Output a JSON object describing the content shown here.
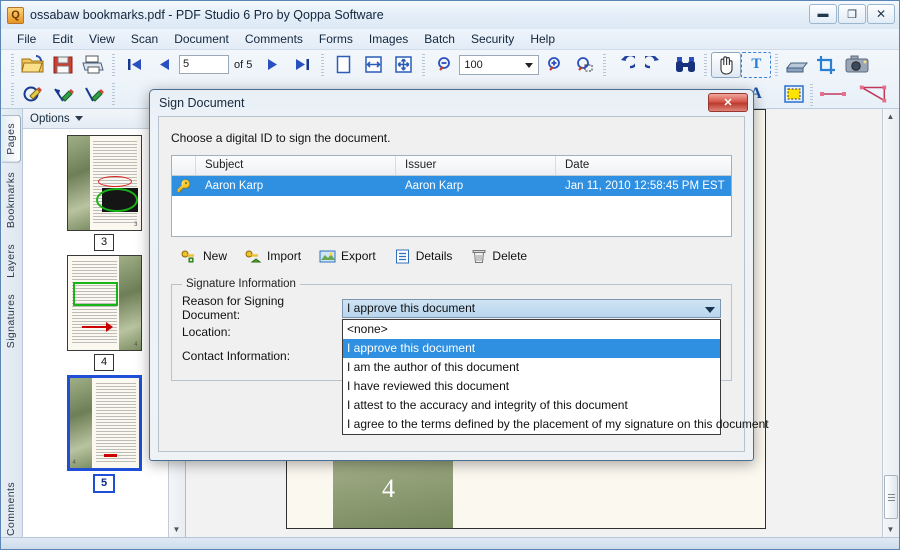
{
  "window": {
    "title": "ossabaw bookmarks.pdf - PDF Studio 6 Pro by Qoppa Software",
    "app_icon": "Q",
    "minimize_label": "▬",
    "maximize_label": "❐",
    "close_label": "✕"
  },
  "menubar": {
    "items": [
      "File",
      "Edit",
      "View",
      "Scan",
      "Document",
      "Comments",
      "Forms",
      "Images",
      "Batch",
      "Security",
      "Help"
    ]
  },
  "toolbar": {
    "open_icon": "open-folder-icon",
    "save_icon": "save-icon",
    "print_icon": "print-icon",
    "first_page_icon": "⏮",
    "prev_page_icon": "◀",
    "page_number": "5",
    "page_total_label": "of 5",
    "next_page_icon": "▶",
    "last_page_icon": "⏭",
    "zoom_value": "100",
    "rotate_left_icon": "↺",
    "rotate_right_icon": "↻",
    "search_icon": "binoculars-icon",
    "hand_tool_icon": "✋",
    "text_tool_icon": "T",
    "scan_icon": "scanner-icon",
    "crop_icon": "crop-icon",
    "snapshot_icon": "camera-icon",
    "spellcheck_icon": "A",
    "highlight_icon": "highlight-icon"
  },
  "sidebar": {
    "tabs": [
      {
        "label": "Pages",
        "selected": true
      },
      {
        "label": "Bookmarks",
        "selected": false
      },
      {
        "label": "Layers",
        "selected": false
      },
      {
        "label": "Signatures",
        "selected": false
      },
      {
        "label": "Comments",
        "selected": false
      }
    ],
    "options_label": "Options",
    "thumbnails": [
      {
        "number": "3",
        "selected": false
      },
      {
        "number": "4",
        "selected": false
      },
      {
        "number": "5",
        "selected": true
      }
    ]
  },
  "document": {
    "visible_page_number": "4"
  },
  "dialog": {
    "title": "Sign Document",
    "close_label": "✕",
    "prompt": "Choose a digital ID to sign the document.",
    "table": {
      "columns": [
        "",
        "Subject",
        "Issuer",
        "Date"
      ],
      "rows": [
        {
          "icon": "key-icon",
          "subject": "Aaron Karp",
          "issuer": "Aaron Karp",
          "date": "Jan 11, 2010 12:58:45 PM EST",
          "selected": true
        }
      ]
    },
    "buttons": [
      {
        "label": "New",
        "icon": "key-add-icon"
      },
      {
        "label": "Import",
        "icon": "key-import-icon"
      },
      {
        "label": "Export",
        "icon": "image-export-icon"
      },
      {
        "label": "Details",
        "icon": "details-list-icon"
      },
      {
        "label": "Delete",
        "icon": "trash-icon"
      }
    ],
    "signature_information": {
      "legend": "Signature Information",
      "reason_label": "Reason for Signing Document:",
      "reason_value": "I approve this document",
      "location_label": "Location:",
      "location_value": "",
      "contact_label": "Contact Information:",
      "contact_value": "",
      "reason_options": [
        {
          "label": "<none>",
          "selected": false
        },
        {
          "label": "I approve this document",
          "selected": true
        },
        {
          "label": "I am the author of this document",
          "selected": false
        },
        {
          "label": "I have reviewed this document",
          "selected": false
        },
        {
          "label": "I attest to the accuracy and integrity of this document",
          "selected": false
        },
        {
          "label": "I agree to the terms defined by the placement of my signature on this document",
          "selected": false
        }
      ]
    }
  },
  "colors": {
    "selection_blue": "#2f8fe0",
    "close_red": "#bb3a2d",
    "thumb_selected_border": "#1f4fd8"
  }
}
